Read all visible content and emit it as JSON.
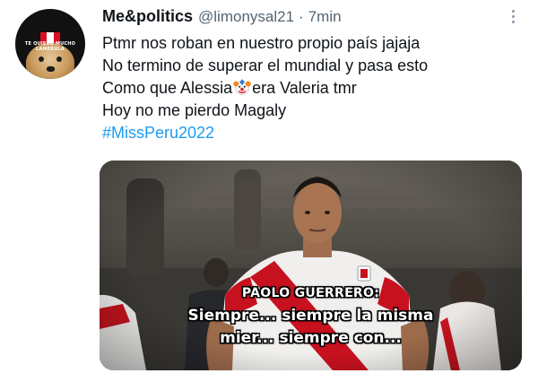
{
  "user": {
    "display_name": "Me&politics",
    "handle": "@limonysal21",
    "separator": "·",
    "time": "7min",
    "avatar_text": "TE QUIERO MUCHO LAMERULA"
  },
  "tweet": {
    "line1": "Ptmr nos roban en nuestro propio país jajaja",
    "line2": "No termino de superar el mundial y pasa esto",
    "line3_before": "Como que Alessia",
    "line3_emoji": "clown-face",
    "line3_after": "era Valeria tmr",
    "line4": "Hoy no me pierdo Magaly",
    "hashtag": "#MissPeru2022"
  },
  "media": {
    "speaker": "PAOLO GUERRERO:",
    "subtitle_line1": "Siempre... siempre la misma",
    "subtitle_line2": "mier... siempre con..."
  },
  "icons": {
    "more": "more-options-icon"
  },
  "colors": {
    "text": "#0f1419",
    "secondary": "#536471",
    "hashtag": "#1d9bf0",
    "peru_red": "#d91023"
  }
}
